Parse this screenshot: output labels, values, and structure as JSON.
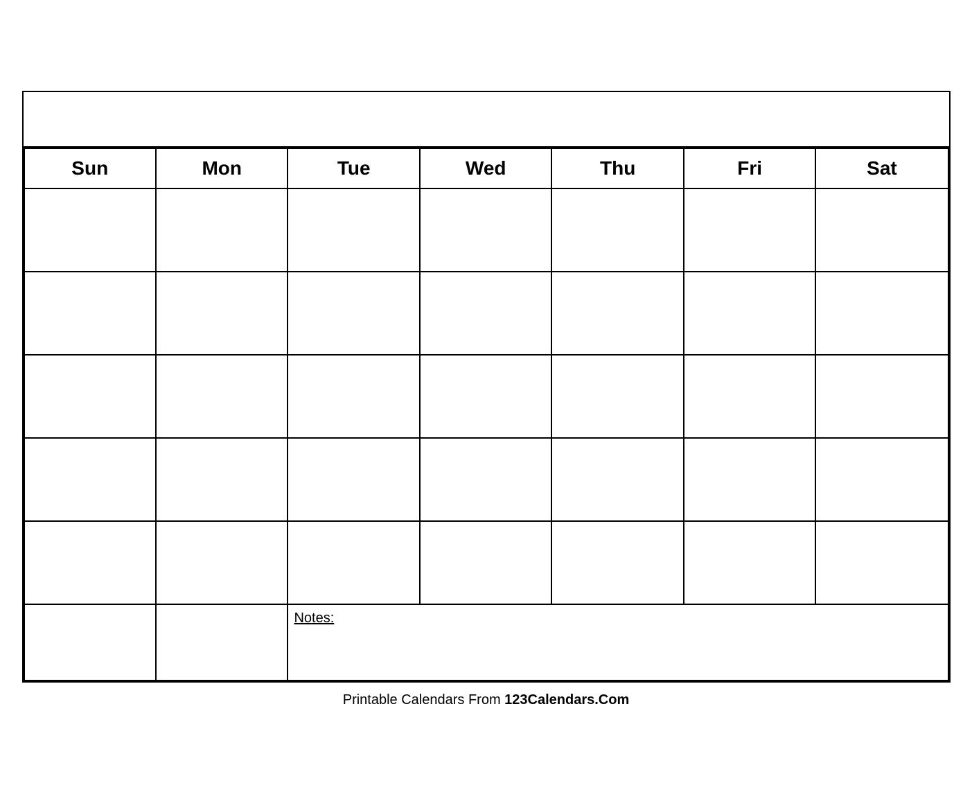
{
  "calendar": {
    "title": "",
    "days": {
      "sun": "Sun",
      "mon": "Mon",
      "tue": "Tue",
      "wed": "Wed",
      "thu": "Thu",
      "fri": "Fri",
      "sat": "Sat"
    },
    "notes_label": "Notes:"
  },
  "footer": {
    "text_plain": "Printable Calendars From ",
    "text_bold": "123Calendars.Com"
  }
}
